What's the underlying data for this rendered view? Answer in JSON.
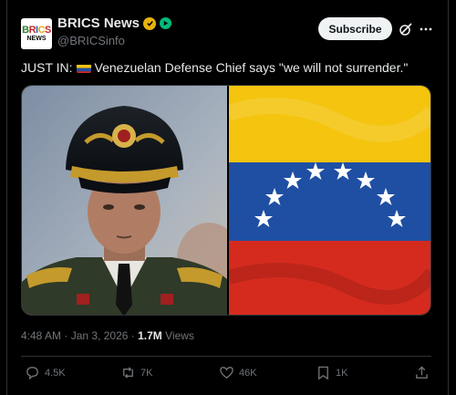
{
  "account": {
    "name": "BRICS News",
    "handle": "@BRICSinfo",
    "avatar_line1": [
      "B",
      "R",
      "I",
      "C",
      "S"
    ],
    "avatar_line2": "NEWS",
    "avatar_colors": [
      "#2e7d32",
      "#c62828",
      "#1565c0",
      "#e8a90d",
      "#c62828"
    ]
  },
  "header": {
    "subscribe_label": "Subscribe",
    "grok_icon": "grok-icon",
    "more_icon": "more-icon"
  },
  "tweet": {
    "prefix": "JUST IN:",
    "flag_icon": "venezuela-flag-icon",
    "text": "Venezuelan Defense Chief says \"we will not surrender.\""
  },
  "media": {
    "left_image": "portrait of defense chief in military uniform and cap",
    "right_image": "flag of Venezuela with arc of eight white stars"
  },
  "meta": {
    "time": "4:48 AM",
    "separator": "·",
    "date": "Jan 3, 2026",
    "views_count": "1.7M",
    "views_label": "Views"
  },
  "actions": {
    "replies": "4.5K",
    "reposts": "7K",
    "likes": "46K",
    "bookmarks": "1K"
  },
  "colors": {
    "background": "#000000",
    "text": "#e7e9ea",
    "muted": "#71767b",
    "border": "#2f3336",
    "verified_gold": "#e8b20d",
    "badge_green": "#00ba7c",
    "flag_yellow": "#f4c40f",
    "flag_blue": "#1f4fa3",
    "flag_red": "#d52b1e"
  }
}
